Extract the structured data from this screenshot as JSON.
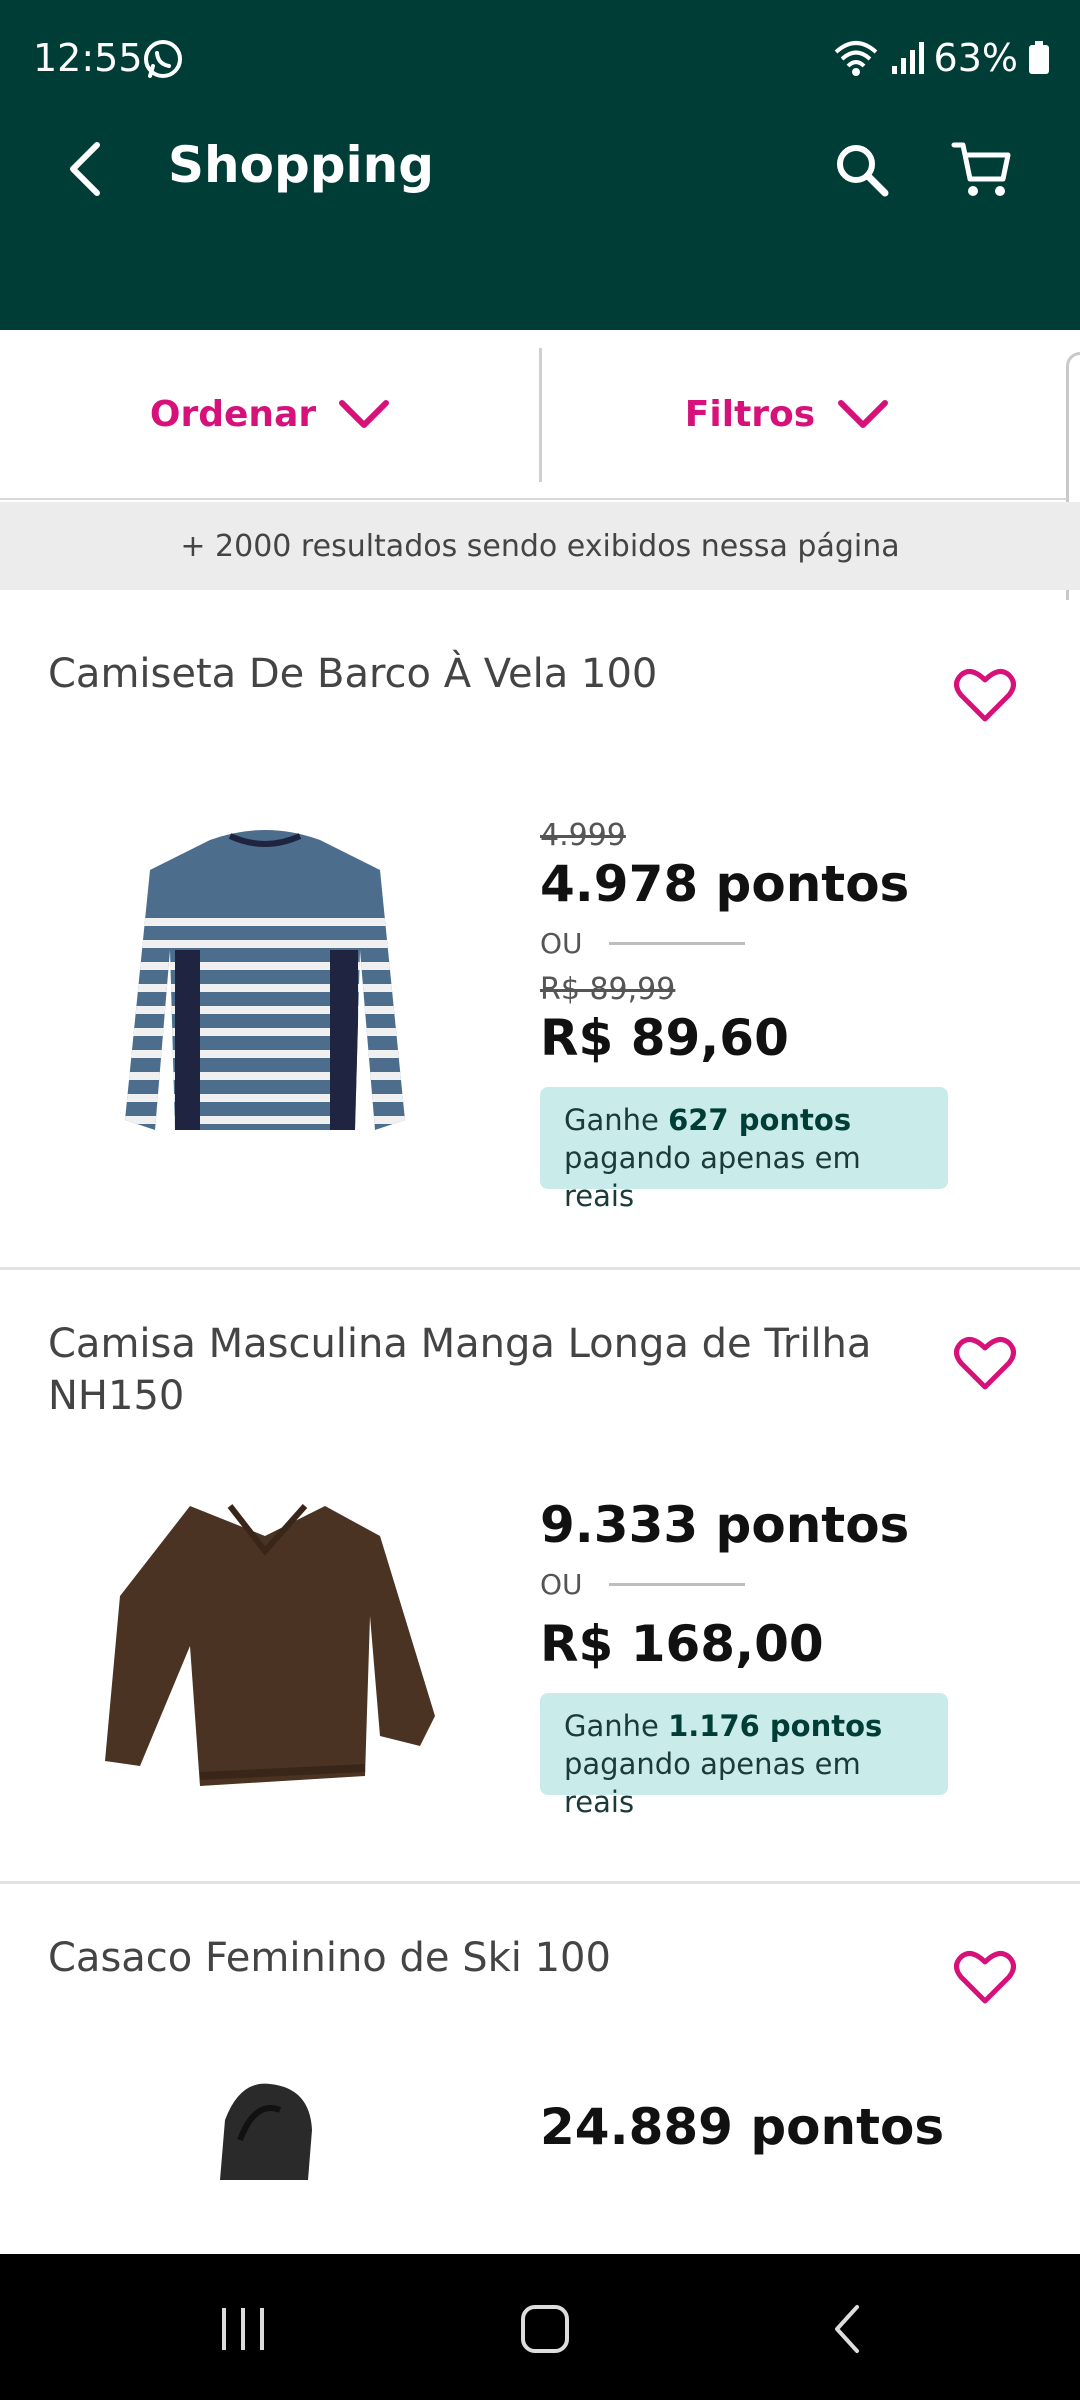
{
  "status": {
    "time": "12:55",
    "battery": "63%"
  },
  "appbar": {
    "title": "Shopping"
  },
  "sortbar": {
    "sort_label": "Ordenar",
    "filter_label": "Filtros"
  },
  "results": {
    "text": "+ 2000 resultados sendo exibidos nessa página"
  },
  "products": [
    {
      "title": "Camiseta De Barco À Vela 100",
      "old_points": "4.999",
      "points": "4.978 pontos",
      "or": "OU",
      "old_price": "R$ 89,99",
      "price": "R$ 89,60",
      "earn_prefix": "Ganhe ",
      "earn_points": "627 pontos",
      "earn_suffix": "pagando apenas em reais"
    },
    {
      "title": "Camisa Masculina Manga Longa de Trilha NH150",
      "points": "9.333 pontos",
      "or": "OU",
      "price": "R$ 168,00",
      "earn_prefix": "Ganhe ",
      "earn_points": "1.176 pontos",
      "earn_suffix": "pagando apenas em reais"
    },
    {
      "title": "Casaco Feminino de Ski 100",
      "points": "24.889 pontos"
    }
  ],
  "colors": {
    "header": "#003d36",
    "accent": "#d6127a",
    "earn_bg": "#c9ecea"
  },
  "icons": [
    "whatsapp-icon",
    "wifi-icon",
    "signal-icon",
    "battery-icon",
    "back-arrow-icon",
    "search-icon",
    "cart-icon",
    "chevron-down-icon",
    "heart-icon",
    "recents-icon",
    "home-icon",
    "nav-back-icon"
  ]
}
